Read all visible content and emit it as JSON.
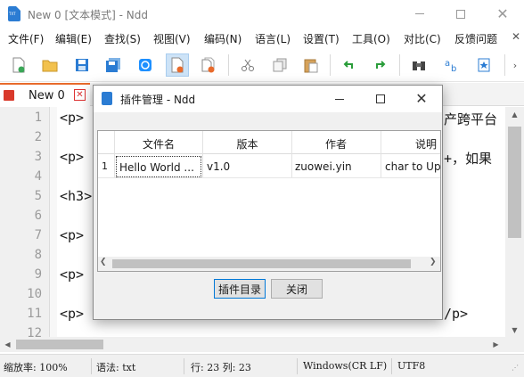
{
  "window": {
    "title": "New 0 [文本模式] - Ndd",
    "app_icon_text": "TXT"
  },
  "menu": {
    "items": [
      "文件(F)",
      "编辑(E)",
      "查找(S)",
      "视图(V)",
      "编码(N)",
      "语言(L)",
      "设置(T)",
      "工具(O)",
      "对比(C)",
      "反馈问题"
    ],
    "close_glyph": "✕"
  },
  "toolbar": {
    "buttons": [
      "new-file",
      "open-folder",
      "save",
      "save-all",
      "reload",
      "close-file",
      "close-all",
      "cut",
      "copy",
      "paste",
      "undo",
      "redo",
      "find",
      "replace",
      "bookmark"
    ],
    "active": "close-file"
  },
  "tabs": [
    {
      "label": "New 0",
      "close": "✕"
    }
  ],
  "editor": {
    "line_numbers": [
      "1",
      "2",
      "3",
      "4",
      "5",
      "6",
      "7",
      "8",
      "9",
      "10",
      "11",
      "12"
    ],
    "visible_code": {
      "line1": "<p>",
      "line1_right": "产跨平台",
      "line3": "<p>",
      "line3_right": "+，如果",
      "line5": "<h3>",
      "line7": "<p>",
      "line9": "<p>",
      "line11": "<p>",
      "line11_right": "/p>"
    }
  },
  "statusbar": {
    "zoom": "缩放率: 100%",
    "syntax": "语法: txt",
    "position": "行: 23 列: 23",
    "eol": "Windows(CR LF)",
    "encoding": "UTF8"
  },
  "dialog": {
    "title": "插件管理 - Ndd",
    "columns": [
      "文件名",
      "版本",
      "作者",
      "说明"
    ],
    "rows": [
      {
        "num": "1",
        "file": "Hello World ...",
        "version": "v1.0",
        "author": "zuowei.yin",
        "desc": "char to Upp"
      }
    ],
    "buttons": {
      "plugin_dir": "插件目录",
      "close": "关闭"
    }
  },
  "colors": {
    "accent": "#2b7cd3",
    "tab_accent": "#e86a2b",
    "close_red": "#d33333",
    "toolbar_active": "#cde3f7"
  }
}
